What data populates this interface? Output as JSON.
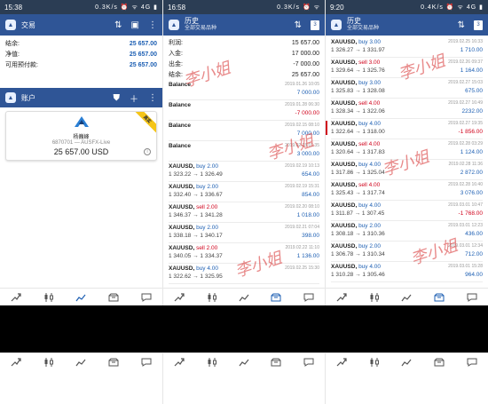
{
  "p1": {
    "status": {
      "time": "15:38",
      "icons": "0.3K/s ⏰ ᯤ 4G ▮"
    },
    "appbar": {
      "title": "交易"
    },
    "summary": [
      {
        "label": "结余:",
        "value": "25 657.00"
      },
      {
        "label": "净值:",
        "value": "25 657.00"
      },
      {
        "label": "可用预付款:",
        "value": "25 657.00"
      }
    ],
    "account": {
      "bar_title": "账户",
      "ribbon": "真实",
      "name": "杨巍峰",
      "number": "6870701 — AUSFX-Live",
      "balance": "25 657.00 USD"
    }
  },
  "p2": {
    "status": {
      "time": "16:58",
      "icons": "0.3K/s ⏰ ᯤ"
    },
    "appbar": {
      "title": "历史",
      "subtitle": "全部交易品种"
    },
    "summary": [
      {
        "label": "利润:",
        "value": "15 657.00"
      },
      {
        "label": "入金:",
        "value": "17 000.00"
      },
      {
        "label": "出金:",
        "value": "-7 000.00"
      },
      {
        "label": "结余:",
        "value": "25 657.00"
      }
    ],
    "rows": [
      {
        "kind": "balance",
        "symbol": "Balance",
        "time": "2019.01.26 10:05",
        "value": "7 000.00",
        "neg": false
      },
      {
        "kind": "balance",
        "symbol": "Balance",
        "time": "2019.01.28 06:30",
        "value": "-7 000.00",
        "neg": true
      },
      {
        "kind": "balance",
        "symbol": "Balance",
        "time": "2019.02.15 08:10",
        "value": "7 000.00",
        "neg": false
      },
      {
        "kind": "balance",
        "symbol": "Balance",
        "time": "2019.02.18 01:35",
        "value": "3 000.00",
        "neg": false
      },
      {
        "kind": "trade",
        "symbol": "XAUUSD,",
        "side": "buy 2.00",
        "buy": true,
        "time": "2019.02.19 10:13",
        "prices": "1 323.22 → 1 326.49",
        "value": "654.00",
        "neg": false
      },
      {
        "kind": "trade",
        "symbol": "XAUUSD,",
        "side": "buy 2.00",
        "buy": true,
        "time": "2019.02.19 15:31",
        "prices": "1 332.40 → 1 336.67",
        "value": "854.00",
        "neg": false
      },
      {
        "kind": "trade",
        "symbol": "XAUUSD,",
        "side": "sell 2.00",
        "buy": false,
        "time": "2019.02.20 08:10",
        "prices": "1 346.37 → 1 341.28",
        "value": "1 018.00",
        "neg": false
      },
      {
        "kind": "trade",
        "symbol": "XAUUSD,",
        "side": "buy 2.00",
        "buy": true,
        "time": "2019.02.21 07:04",
        "prices": "1 338.18 → 1 340.17",
        "value": "398.00",
        "neg": false
      },
      {
        "kind": "trade",
        "symbol": "XAUUSD,",
        "side": "sell 2.00",
        "buy": false,
        "time": "2019.02.22 11:10",
        "prices": "1 340.05 → 1 334.37",
        "value": "1 136.00",
        "neg": false
      },
      {
        "kind": "trade",
        "symbol": "XAUUSD,",
        "side": "buy 4.00",
        "buy": true,
        "time": "2019.02.25 15:30",
        "prices": "1 322.62 → 1 325.95",
        "value": "",
        "neg": false
      }
    ]
  },
  "p3": {
    "status": {
      "time": "9:20",
      "icons": "0.4K/s ⏰ ᯤ 4G ▮"
    },
    "appbar": {
      "title": "历史",
      "subtitle": "全部交易品种"
    },
    "rows": [
      {
        "symbol": "XAUUSD,",
        "side": "buy 3.00",
        "buy": true,
        "time": "2019.02.25 16:33",
        "prices": "1 326.27 → 1 331.97",
        "value": "1 710.00",
        "neg": false,
        "marker": false
      },
      {
        "symbol": "XAUUSD,",
        "side": "sell 3.00",
        "buy": false,
        "time": "2019.02.26 09:37",
        "prices": "1 329.64 → 1 325.76",
        "value": "1 164.00",
        "neg": false,
        "marker": false
      },
      {
        "symbol": "XAUUSD,",
        "side": "buy 3.00",
        "buy": true,
        "time": "2019.02.27 15:03",
        "prices": "1 325.83 → 1 328.08",
        "value": "675.00",
        "neg": false,
        "marker": false
      },
      {
        "symbol": "XAUUSD,",
        "side": "sell 4.00",
        "buy": false,
        "time": "2019.02.27 16:49",
        "prices": "1 328.34 → 1 322.06",
        "value": "2232.00",
        "neg": false,
        "marker": false
      },
      {
        "symbol": "XAUUSD,",
        "side": "buy 4.00",
        "buy": true,
        "time": "2019.02.27 19:35",
        "prices": "1 322.64 → 1 318.00",
        "value": "-1 856.00",
        "neg": true,
        "marker": true
      },
      {
        "symbol": "XAUUSD,",
        "side": "sell 4.00",
        "buy": false,
        "time": "2019.02.28 03:29",
        "prices": "1 320.64 → 1 317.83",
        "value": "1 124.00",
        "neg": false,
        "marker": false
      },
      {
        "symbol": "XAUUSD,",
        "side": "buy 4.00",
        "buy": true,
        "time": "2019.02.28 11:36",
        "prices": "1 317.86 → 1 325.04",
        "value": "2 872.00",
        "neg": false,
        "marker": false
      },
      {
        "symbol": "XAUUSD,",
        "side": "sell 4.00",
        "buy": false,
        "time": "2019.02.28 16:40",
        "prices": "1 325.43 → 1 317.74",
        "value": "3 076.00",
        "neg": false,
        "marker": false
      },
      {
        "symbol": "XAUUSD,",
        "side": "buy 4.00",
        "buy": true,
        "time": "2019.03.01 10:47",
        "prices": "1 311.87 → 1 307.45",
        "value": "-1 768.00",
        "neg": true,
        "marker": false
      },
      {
        "symbol": "XAUUSD,",
        "side": "buy 2.00",
        "buy": true,
        "time": "2019.03.01 12:23",
        "prices": "1 308.18 → 1 310.36",
        "value": "436.00",
        "neg": false,
        "marker": false
      },
      {
        "symbol": "XAUUSD,",
        "side": "buy 2.00",
        "buy": true,
        "time": "2019.03.01 12:34",
        "prices": "1 306.78 → 1 310.34",
        "value": "712.00",
        "neg": false,
        "marker": false
      },
      {
        "symbol": "XAUUSD,",
        "side": "buy 4.00",
        "buy": true,
        "time": "2019.03.01 15:28",
        "prices": "1 310.28 → 1 305.46",
        "value": "964.00",
        "neg": false,
        "marker": false
      }
    ]
  },
  "tabs": [
    {
      "icon": "quotes-icon"
    },
    {
      "icon": "candlestick-chart-icon"
    },
    {
      "icon": "trade-icon"
    },
    {
      "icon": "history-icon"
    },
    {
      "icon": "messages-icon"
    }
  ],
  "watermark": "李小姐",
  "colors": {
    "appbar": "#2f5596",
    "blue": "#1d5fb3",
    "red": "#d0021b"
  }
}
